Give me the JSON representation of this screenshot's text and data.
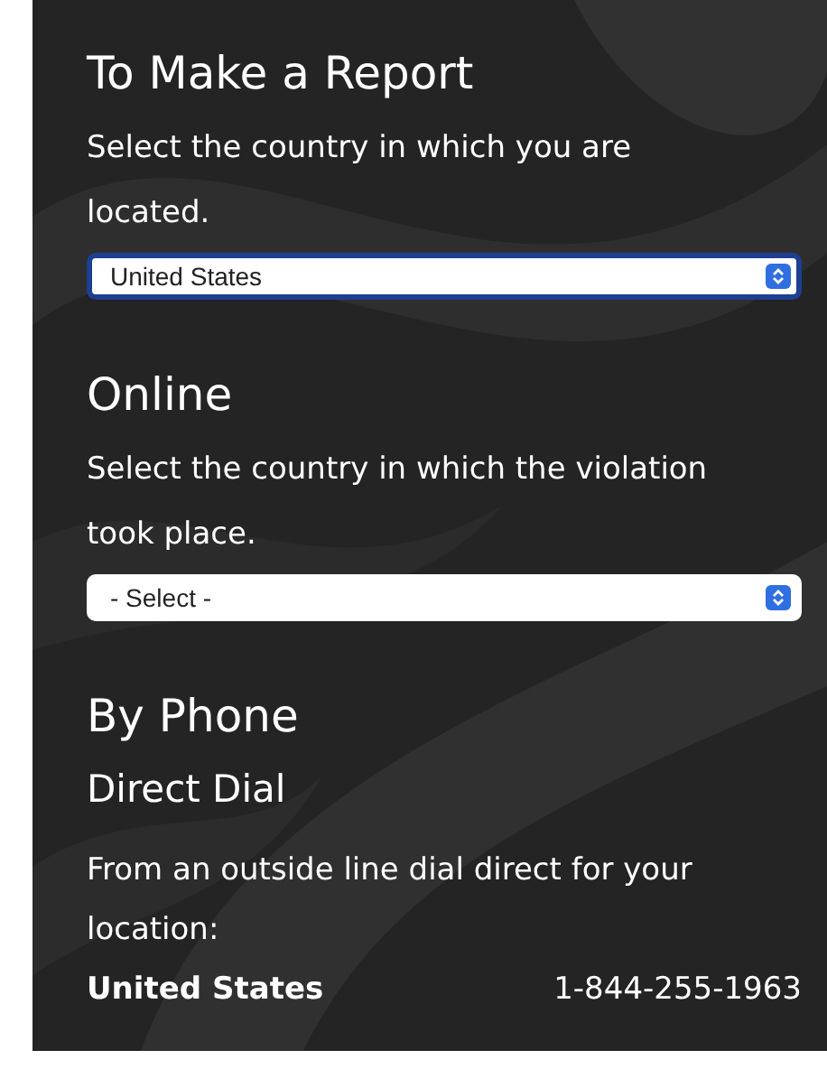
{
  "sections": [
    {
      "kind": "select",
      "title": "To Make a Report",
      "text": "Select the country in which you are located.",
      "select": {
        "value": "United States",
        "focused": true
      }
    },
    {
      "kind": "select",
      "title": "Online",
      "text": "Select the country in which the violation took place.",
      "select": {
        "value": "- Select -",
        "focused": false
      }
    },
    {
      "kind": "phone",
      "title": "By Phone",
      "subtitle": "Direct Dial",
      "text": "From an outside line dial direct for your location:",
      "entries": [
        {
          "country": "United States",
          "number": "1-844-255-1963"
        }
      ]
    }
  ]
}
